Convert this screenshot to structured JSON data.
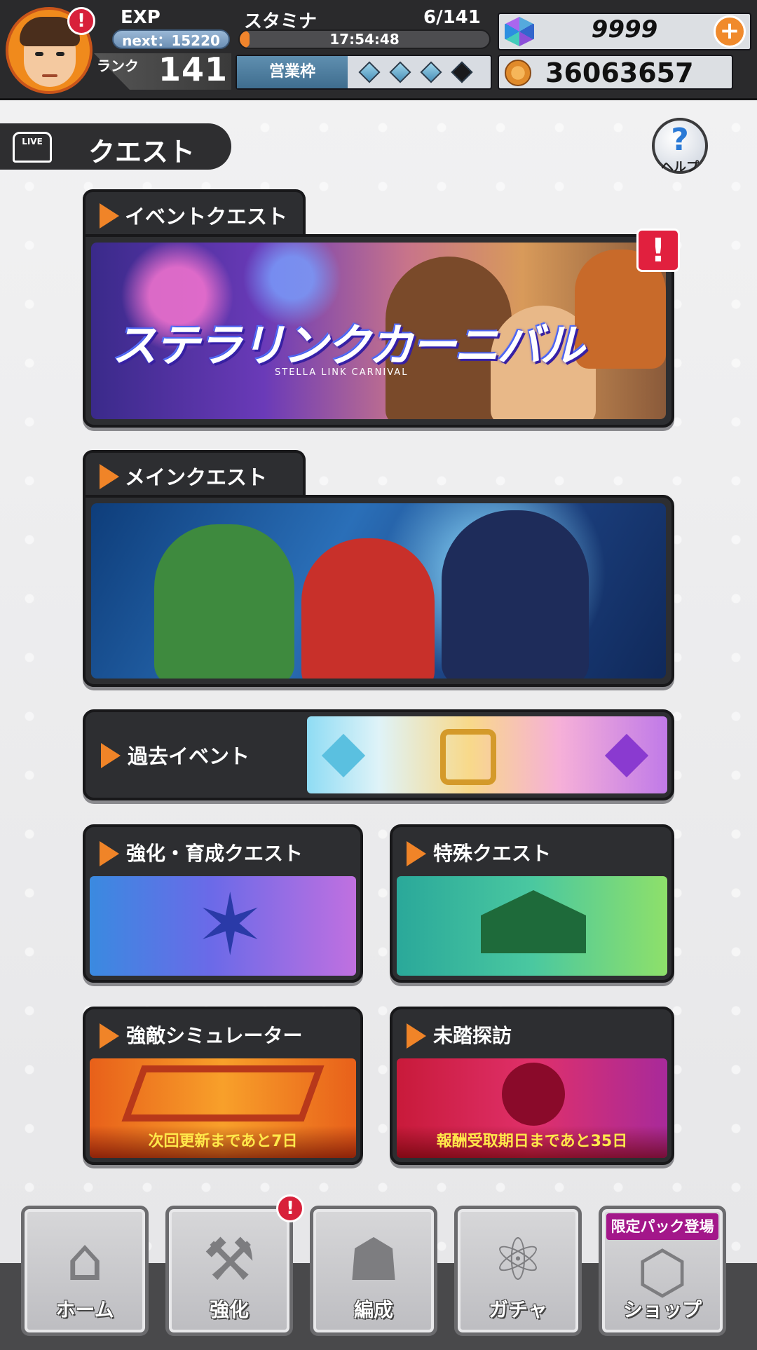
{
  "header": {
    "exp_label": "EXP",
    "exp_next": "next：15220",
    "rank_label": "ランク",
    "rank_value": "141",
    "stamina_label": "スタミナ",
    "stamina_value": "6/141",
    "stamina_fraction": 0.04,
    "stamina_timer": "17:54:48",
    "sales_slot_label": "営業枠",
    "sales_slot_filled": 3,
    "sales_slot_total": 4,
    "gems": "9999",
    "coins": "36063657",
    "alert_mark": "!"
  },
  "page": {
    "title": "クエスト",
    "live_icon": "LIVE",
    "help_glyph": "?",
    "help_label": "ヘルプ"
  },
  "quests": {
    "event": {
      "label": "イベントクエスト",
      "logo": "ステラリンクカーニバル",
      "logo_sub": "STELLA LINK CARNIVAL",
      "alert": "!"
    },
    "main": {
      "label": "メインクエスト"
    },
    "past": {
      "label": "過去イベント"
    },
    "training": {
      "label": "強化・育成クエスト"
    },
    "special": {
      "label": "特殊クエスト"
    },
    "simulator": {
      "label": "強敵シミュレーター",
      "note": "次回更新まであと7日"
    },
    "exploration": {
      "label": "未踏探訪",
      "note": "報酬受取期日まであと35日"
    }
  },
  "nav": {
    "home": "ホーム",
    "enhance": "強化",
    "enhance_alert": "!",
    "formation": "編成",
    "gacha": "ガチャ",
    "shop": "ショップ",
    "shop_ribbon": "限定パック登場"
  },
  "colors": {
    "accent_orange": "#f08428",
    "alert_red": "#e1203e",
    "header_bg": "#2a2a2c"
  }
}
